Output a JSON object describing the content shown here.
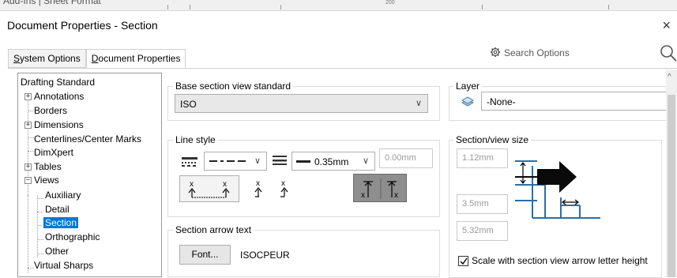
{
  "background_strip": {
    "text": "Add-Ins  |  Sheet Format",
    "mid_label": "200"
  },
  "window": {
    "title": "Document Properties - Section",
    "close_glyph": "×"
  },
  "tabs": [
    {
      "label": "System Options",
      "accel": "S",
      "rest": "ystem Options",
      "active": false
    },
    {
      "label": "Document Properties",
      "accel": "D",
      "rest": "ocument Properties",
      "active": true
    }
  ],
  "search": {
    "placeholder": "Search Options"
  },
  "tree": {
    "items": [
      {
        "label": "Drafting Standard"
      },
      {
        "label": "Annotations"
      },
      {
        "label": "Borders"
      },
      {
        "label": "Dimensions"
      },
      {
        "label": "Centerlines/Center Marks"
      },
      {
        "label": "DimXpert"
      },
      {
        "label": "Tables"
      },
      {
        "label": "Views"
      },
      {
        "label": "Auxiliary"
      },
      {
        "label": "Detail"
      },
      {
        "label": "Section",
        "selected": true
      },
      {
        "label": "Orthographic"
      },
      {
        "label": "Other"
      },
      {
        "label": "Virtual Sharps"
      }
    ]
  },
  "base_section": {
    "label": "Base section view standard",
    "value": "ISO"
  },
  "layer": {
    "label": "Layer",
    "value": "-None-"
  },
  "line_style": {
    "label": "Line style",
    "thickness": "0.35mm",
    "custom_thickness": "0.00mm"
  },
  "section_view_size": {
    "label": "Section/view size",
    "values": [
      "1.12mm",
      "3.5mm",
      "5.32mm"
    ],
    "scale_checkbox": {
      "label": "Scale with section view arrow letter height",
      "accel": "c",
      "checked": true
    }
  },
  "arrow_text": {
    "label": "Section arrow text",
    "font_button": "Font...",
    "font_name": "ISOCPEUR"
  },
  "colors": {
    "selection": "#0078d7",
    "diagram_blue": "#2a6fa8"
  }
}
